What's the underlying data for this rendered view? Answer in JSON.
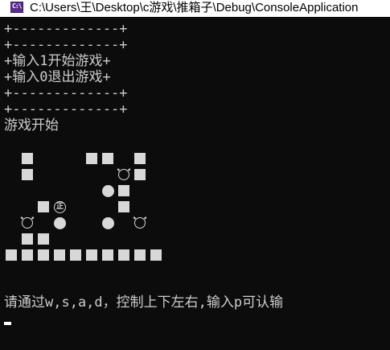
{
  "window": {
    "title": "C:\\Users\\王\\Desktop\\c游戏\\推箱子\\Debug\\ConsoleApplication",
    "icon": "console-app-icon",
    "icon_text": "C:\\"
  },
  "console": {
    "menu_lines": [
      "+-------------+",
      "+-------------+",
      "+输入1开始游戏+",
      "+输入0退出游戏+",
      "+-------------+",
      "+-------------+"
    ],
    "status": "游戏开始",
    "prompt": "请通过w,s,a,d，控制上下左右,输入p可认输",
    "player_glyph": "正",
    "colors": {
      "background": "#0c0c0c",
      "text": "#cccccc",
      "tile": "#d8d8d8"
    }
  },
  "board": {
    "legend": {
      "wall": "filled-square",
      "box": "filled-circle",
      "target": "hollow-circle",
      "player": "circled-glyph"
    },
    "rows": [
      [
        "empty",
        "wall",
        "empty",
        "empty",
        "empty",
        "wall",
        "wall",
        "empty",
        "wall",
        "empty"
      ],
      [
        "empty",
        "wall",
        "empty",
        "empty",
        "empty",
        "empty",
        "empty",
        "target",
        "wall",
        "empty"
      ],
      [
        "empty",
        "empty",
        "empty",
        "empty",
        "empty",
        "empty",
        "box",
        "wall",
        "empty",
        "empty"
      ],
      [
        "empty",
        "empty",
        "wall",
        "player",
        "empty",
        "empty",
        "empty",
        "wall",
        "empty",
        "empty"
      ],
      [
        "empty",
        "target",
        "empty",
        "box",
        "empty",
        "empty",
        "box",
        "empty",
        "target",
        "empty"
      ],
      [
        "empty",
        "wall",
        "wall",
        "empty",
        "empty",
        "empty",
        "empty",
        "empty",
        "empty",
        "empty"
      ],
      [
        "wall",
        "wall",
        "wall",
        "wall",
        "wall",
        "wall",
        "wall",
        "wall",
        "wall",
        "wall"
      ]
    ]
  }
}
